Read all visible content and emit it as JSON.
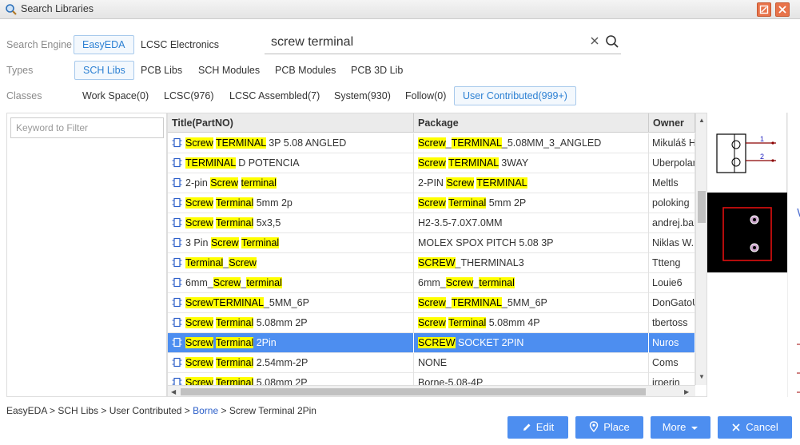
{
  "window": {
    "title": "Search Libraries"
  },
  "engine": {
    "label": "Search Engine",
    "options": [
      "EasyEDA",
      "LCSC Electronics"
    ]
  },
  "search": {
    "value": "screw terminal"
  },
  "types": {
    "label": "Types",
    "options": [
      "SCH Libs",
      "PCB Libs",
      "SCH Modules",
      "PCB Modules",
      "PCB 3D Lib"
    ]
  },
  "classes": {
    "label": "Classes",
    "options": [
      "Work Space(0)",
      "LCSC(976)",
      "LCSC Assembled(7)",
      "System(930)",
      "Follow(0)",
      "User Contributed(999+)"
    ]
  },
  "filter": {
    "placeholder": "Keyword to Filter"
  },
  "grid": {
    "headers": [
      "Title(PartNO)",
      "Package",
      "Owner"
    ],
    "rows": [
      {
        "title": [
          [
            "Screw",
            true
          ],
          [
            " ",
            false
          ],
          [
            "TERMINAL",
            true
          ],
          [
            " 3P 5.08 ANGLED",
            false
          ]
        ],
        "package": [
          [
            "Screw",
            true
          ],
          [
            "_",
            false
          ],
          [
            "TERMINAL",
            true
          ],
          [
            "_5.08MM_3_ANGLED",
            false
          ]
        ],
        "owner": "Mikuláš H"
      },
      {
        "title": [
          [
            "TERMINAL",
            true
          ],
          [
            " D POTENCIA",
            false
          ]
        ],
        "package": [
          [
            "Screw",
            true
          ],
          [
            " ",
            false
          ],
          [
            "TERMINAL",
            true
          ],
          [
            " 3WAY",
            false
          ]
        ],
        "owner": "Uberpolar"
      },
      {
        "title": [
          [
            "2-pin ",
            false
          ],
          [
            "Screw",
            true
          ],
          [
            " ",
            false
          ],
          [
            "terminal",
            true
          ]
        ],
        "package": [
          [
            "2-PIN ",
            false
          ],
          [
            "Screw",
            true
          ],
          [
            " ",
            false
          ],
          [
            "TERMINAL",
            true
          ]
        ],
        "owner": "Meltls"
      },
      {
        "title": [
          [
            "Screw",
            true
          ],
          [
            " ",
            false
          ],
          [
            "Terminal",
            true
          ],
          [
            " 5mm 2p",
            false
          ]
        ],
        "package": [
          [
            "Screw",
            true
          ],
          [
            " ",
            false
          ],
          [
            "Terminal",
            true
          ],
          [
            " 5mm 2P",
            false
          ]
        ],
        "owner": "poloking"
      },
      {
        "title": [
          [
            "Screw",
            true
          ],
          [
            " ",
            false
          ],
          [
            "Terminal",
            true
          ],
          [
            " 5x3,5",
            false
          ]
        ],
        "package": [
          [
            "H2-3.5-7.0X7.0MM",
            false
          ]
        ],
        "owner": "andrej.bal"
      },
      {
        "title": [
          [
            "3 Pin ",
            false
          ],
          [
            "Screw",
            true
          ],
          [
            " ",
            false
          ],
          [
            "Terminal",
            true
          ]
        ],
        "package": [
          [
            "MOLEX SPOX PITCH 5.08 3P",
            false
          ]
        ],
        "owner": "Niklas W."
      },
      {
        "title": [
          [
            "Terminal",
            true
          ],
          [
            "_",
            false
          ],
          [
            "Screw",
            true
          ]
        ],
        "package": [
          [
            "SCREW",
            true
          ],
          [
            "_THERMINAL3",
            false
          ]
        ],
        "owner": "Ttteng"
      },
      {
        "title": [
          [
            "6mm_",
            false
          ],
          [
            "Screw",
            true
          ],
          [
            "_",
            false
          ],
          [
            "terminal",
            true
          ]
        ],
        "package": [
          [
            "6mm_",
            false
          ],
          [
            "Screw",
            true
          ],
          [
            "_",
            false
          ],
          [
            "terminal",
            true
          ]
        ],
        "owner": "Louie6"
      },
      {
        "title": [
          [
            "Screw",
            true
          ],
          [
            "TERMINAL",
            true
          ],
          [
            "_5MM_6P",
            false
          ]
        ],
        "package": [
          [
            "Screw",
            true
          ],
          [
            "_",
            false
          ],
          [
            "TERMINAL",
            true
          ],
          [
            "_5MM_6P",
            false
          ]
        ],
        "owner": "DonGatoU"
      },
      {
        "title": [
          [
            "Screw",
            true
          ],
          [
            " ",
            false
          ],
          [
            "Terminal",
            true
          ],
          [
            " 5.08mm 2P",
            false
          ]
        ],
        "package": [
          [
            "Screw",
            true
          ],
          [
            " ",
            false
          ],
          [
            "Terminal",
            true
          ],
          [
            " 5.08mm 4P",
            false
          ]
        ],
        "owner": "tbertoss"
      },
      {
        "title": [
          [
            "Screw",
            true
          ],
          [
            " ",
            false
          ],
          [
            "Terminal",
            true
          ],
          [
            " 2Pin",
            false
          ]
        ],
        "package": [
          [
            "SCREW",
            true
          ],
          [
            " SOCKET 2PIN",
            false
          ]
        ],
        "owner": "Nuros",
        "selected": true
      },
      {
        "title": [
          [
            "Screw",
            true
          ],
          [
            " ",
            false
          ],
          [
            "Terminal",
            true
          ],
          [
            " 2.54mm-2P",
            false
          ]
        ],
        "package": [
          [
            "NONE",
            false
          ]
        ],
        "owner": "Coms"
      },
      {
        "title": [
          [
            "Screw",
            true
          ],
          [
            " ",
            false
          ],
          [
            "Terminal",
            true
          ],
          [
            " 5.08mm 2P",
            false
          ]
        ],
        "package": [
          [
            "Borne-5.08-4P",
            false
          ]
        ],
        "owner": "irperin"
      }
    ]
  },
  "preview": {
    "pins": [
      "1",
      "2"
    ]
  },
  "breadcrumb": {
    "parts": [
      "EasyEDA > SCH Libs > User Contributed > ",
      "Borne",
      " > Screw Terminal 2Pin"
    ]
  },
  "buttons": {
    "edit": "Edit",
    "place": "Place",
    "more": "More",
    "cancel": "Cancel"
  },
  "colors": {
    "accent": "#4d8ef0",
    "highlight": "#ffff00",
    "link": "#2c80d3"
  }
}
